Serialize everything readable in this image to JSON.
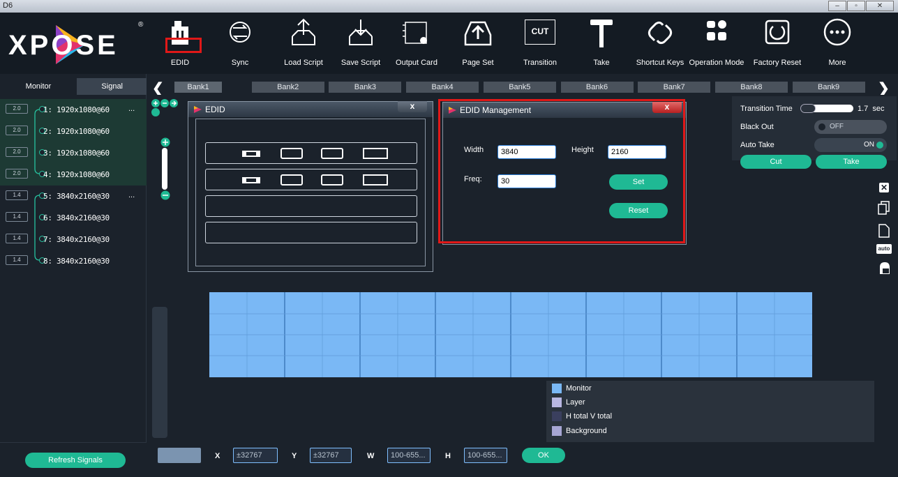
{
  "window": {
    "title": "D6"
  },
  "brand": {
    "logo_text": "XPOSE",
    "registered": "®"
  },
  "toolbar": {
    "items": [
      {
        "label": "EDID",
        "icon": "edid-icon"
      },
      {
        "label": "Sync",
        "icon": "sync-icon"
      },
      {
        "label": "Load Script",
        "icon": "load-script-icon"
      },
      {
        "label": "Save Script",
        "icon": "save-script-icon"
      },
      {
        "label": "Output Card",
        "icon": "output-card-icon"
      },
      {
        "label": "Page Set",
        "icon": "page-set-icon"
      },
      {
        "label": "Transition",
        "icon": "transition-icon",
        "badge": "CUT"
      },
      {
        "label": "Take",
        "icon": "take-icon"
      },
      {
        "label": "Shortcut Keys",
        "icon": "link-icon"
      },
      {
        "label": "Operation Mode",
        "icon": "operation-mode-icon"
      },
      {
        "label": "Factory Reset",
        "icon": "factory-reset-icon"
      },
      {
        "label": "More",
        "icon": "more-icon"
      }
    ]
  },
  "left_panel": {
    "tabs": [
      "Monitor",
      "Signal"
    ],
    "signals": [
      {
        "badge": "2.0",
        "label": "1: 1920x1080@60",
        "more": "..."
      },
      {
        "badge": "2.0",
        "label": "2: 1920x1080@60"
      },
      {
        "badge": "2.0",
        "label": "3: 1920x1080@60"
      },
      {
        "badge": "2.0",
        "label": "4: 1920x1080@60"
      },
      {
        "badge": "1.4",
        "label": "5: 3840x2160@30",
        "more": "..."
      },
      {
        "badge": "1.4",
        "label": "6: 3840x2160@30"
      },
      {
        "badge": "1.4",
        "label": "7: 3840x2160@30"
      },
      {
        "badge": "1.4",
        "label": "8: 3840x2160@30"
      }
    ],
    "refresh_label": "Refresh Signals"
  },
  "banks": [
    "Bank1",
    "Bank2",
    "Bank3",
    "Bank4",
    "Bank5",
    "Bank6",
    "Bank7",
    "Bank8",
    "Bank9"
  ],
  "transition_panel": {
    "time_label": "Transition Time",
    "time_value": "1.7",
    "time_unit": "sec",
    "time_fraction": 0.9,
    "blackout_label": "Black Out",
    "blackout_state": "OFF",
    "autotake_label": "Auto Take",
    "autotake_state": "ON",
    "cut_label": "Cut",
    "take_label": "Take"
  },
  "edid_dialog": {
    "title": "EDID",
    "close": "x"
  },
  "edid_mgmt": {
    "title": "EDID Management",
    "close": "x",
    "width_label": "Width",
    "width_value": "3840",
    "height_label": "Height",
    "height_value": "2160",
    "freq_label": "Freq:",
    "freq_value": "30",
    "set_label": "Set",
    "reset_label": "Reset"
  },
  "legend": [
    "Monitor",
    "Layer",
    "H total V total",
    "Background"
  ],
  "colors": {
    "accent": "#1fb994",
    "highlight_red": "#e01818",
    "grid_blue": "#7ab8f5"
  },
  "bottom_bar": {
    "x_label": "X",
    "x_value": "±32767",
    "y_label": "Y",
    "y_value": "±32767",
    "w_label": "W",
    "w_value": "100-655...",
    "h_label": "H",
    "h_value": "100-655...",
    "ok_label": "OK"
  }
}
